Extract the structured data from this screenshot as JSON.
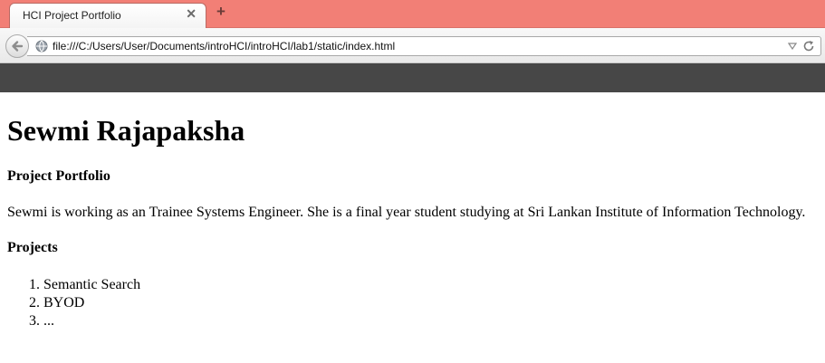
{
  "browser": {
    "tab_title": "HCI Project Portfolio",
    "tab_close": "✕",
    "new_tab": "+",
    "url": "file:///C:/Users/User/Documents/introHCI/introHCI/lab1/static/index.html",
    "icons": [
      "back-arrow-icon",
      "globe-icon",
      "dropdown-icon",
      "reload-icon"
    ]
  },
  "colors": {
    "tabstrip": "#f27f76",
    "dark_bar": "#474747"
  },
  "page": {
    "name": "Sewmi Rajapaksha",
    "subtitle": "Project Portfolio",
    "description": "Sewmi is working as an Trainee Systems Engineer. She is a final year student studying at Sri Lankan Institute of Information Technology.",
    "projects_heading": "Projects",
    "projects": [
      "Semantic Search",
      "BYOD",
      "..."
    ]
  }
}
